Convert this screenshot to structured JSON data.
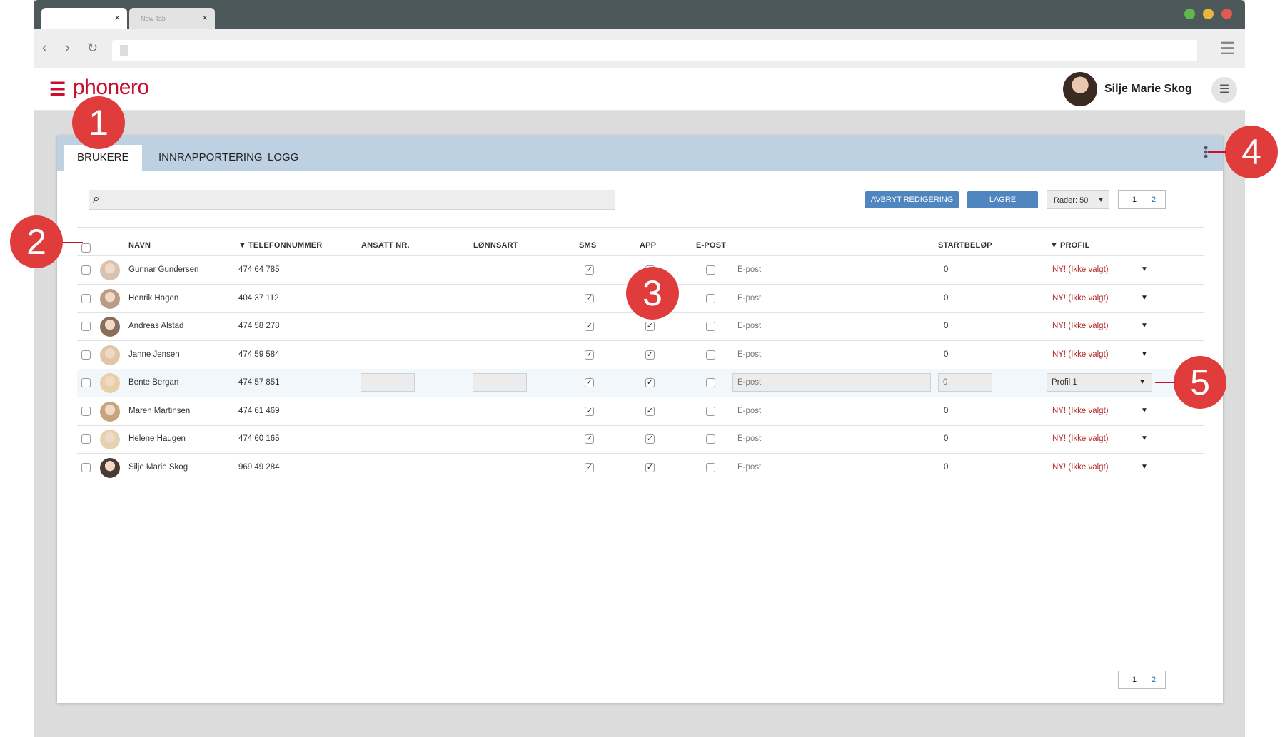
{
  "browser": {
    "tabs": [
      {
        "title": "",
        "close": "×"
      },
      {
        "title": "New Tab",
        "close": "×"
      }
    ],
    "window_dots": [
      "#5fb84a",
      "#e9b53a",
      "#e05a4f"
    ]
  },
  "app": {
    "logo": "phonero",
    "user_name": "Silje Marie Skog",
    "accent_color": "#c8102e",
    "button_color": "#4f86c0"
  },
  "panel": {
    "tabs": [
      "BRUKERE",
      "INNRAPPORTERING",
      "LOGG"
    ],
    "buttons": {
      "cancel": "AVBRYT REDIGERING",
      "save": "LAGRE"
    },
    "rows_select": "Rader: 50",
    "pages": [
      "1",
      "2"
    ]
  },
  "table": {
    "headers": {
      "name": "NAVN",
      "phone": "TELEFONNUMMER",
      "employee_no": "ANSATT NR.",
      "pay_type": "LØNNSART",
      "sms": "SMS",
      "app": "APP",
      "email": "E-POST",
      "start_amount": "STARTBELØP",
      "profile": "PROFIL"
    },
    "rows": [
      {
        "name": "Gunnar Gundersen",
        "phone": "474 64 785",
        "sms": true,
        "app": false,
        "email_chk": false,
        "email": "E-post",
        "start": "0",
        "profile": "NY! (Ikke valgt)"
      },
      {
        "name": "Henrik Hagen",
        "phone": "404 37 112",
        "sms": true,
        "app": false,
        "email_chk": false,
        "email": "E-post",
        "start": "0",
        "profile": "NY! (Ikke valgt)"
      },
      {
        "name": "Andreas Alstad",
        "phone": "474 58 278",
        "sms": true,
        "app": true,
        "email_chk": false,
        "email": "E-post",
        "start": "0",
        "profile": "NY! (Ikke valgt)"
      },
      {
        "name": "Janne Jensen",
        "phone": "474 59 584",
        "sms": true,
        "app": true,
        "email_chk": false,
        "email": "E-post",
        "start": "0",
        "profile": "NY! (Ikke valgt)"
      },
      {
        "name": "Bente Bergan",
        "phone": "474 57 851",
        "sms": true,
        "app": true,
        "email_chk": false,
        "email": "E-post",
        "start": "0",
        "profile": "Profil 1",
        "editing": true
      },
      {
        "name": "Maren Martinsen",
        "phone": "474 61 469",
        "sms": true,
        "app": true,
        "email_chk": false,
        "email": "E-post",
        "start": "0",
        "profile": "NY! (Ikke valgt)"
      },
      {
        "name": "Helene Haugen",
        "phone": "474 60 165",
        "sms": true,
        "app": true,
        "email_chk": false,
        "email": "E-post",
        "start": "0",
        "profile": "NY! (Ikke valgt)"
      },
      {
        "name": "Silje Marie Skog",
        "phone": "969 49 284",
        "sms": true,
        "app": true,
        "email_chk": false,
        "email": "E-post",
        "start": "0",
        "profile": "NY! (Ikke valgt)"
      }
    ]
  },
  "callouts": [
    "1",
    "2",
    "3",
    "4",
    "5"
  ]
}
